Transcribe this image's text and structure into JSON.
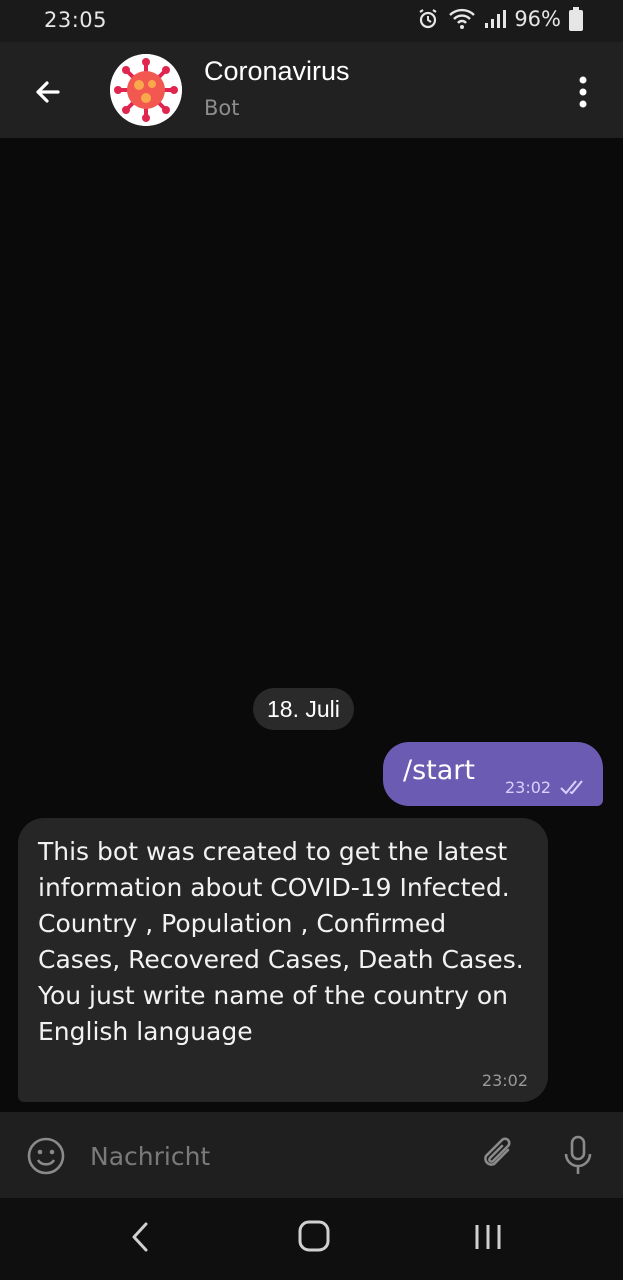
{
  "status_bar": {
    "time": "23:05",
    "battery": "96%",
    "icons": [
      "alarm-icon",
      "wifi-icon",
      "signal-icon",
      "battery-icon"
    ]
  },
  "header": {
    "title": "Coronavirus",
    "subtitle": "Bot",
    "avatar_icon": "virus-icon"
  },
  "chat": {
    "date_label": "18. Juli",
    "messages": [
      {
        "direction": "outgoing",
        "text": "/start",
        "time": "23:02",
        "status": "read"
      },
      {
        "direction": "incoming",
        "text": "This bot was created to get the latest information about COVID-19 Infected. Country , Population , Confirmed Cases, Recovered Cases, Death Cases. You just write name of the country on English language",
        "time": "23:02"
      }
    ]
  },
  "composer": {
    "placeholder": "Nachricht"
  },
  "colors": {
    "outgoing_bubble": "#6c5bb2",
    "incoming_bubble": "#262626",
    "header_bg": "#212121",
    "background": "#0a0a0a"
  }
}
